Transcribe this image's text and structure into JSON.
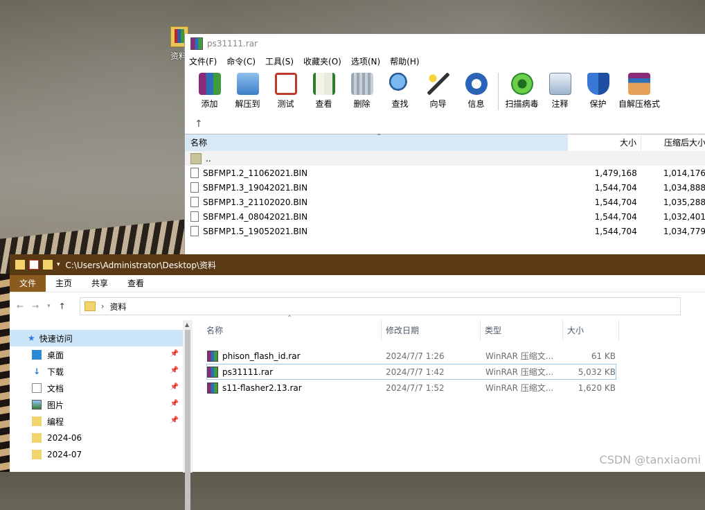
{
  "desktop": {
    "icon_label": "资料"
  },
  "winrar": {
    "title": "ps31111.rar",
    "menu": [
      "文件(F)",
      "命令(C)",
      "工具(S)",
      "收藏夹(O)",
      "选项(N)",
      "帮助(H)"
    ],
    "toolbar": [
      "添加",
      "解压到",
      "测试",
      "查看",
      "删除",
      "查找",
      "向导",
      "信息",
      "扫描病毒",
      "注释",
      "保护",
      "自解压格式"
    ],
    "up_arrow": "↑",
    "columns": {
      "name": "名称",
      "size": "大小",
      "packed": "压缩后大小"
    },
    "parent_row": "..",
    "files": [
      {
        "name": "SBFMP1.2_11062021.BIN",
        "size": "1,479,168",
        "packed": "1,014,176"
      },
      {
        "name": "SBFMP1.3_19042021.BIN",
        "size": "1,544,704",
        "packed": "1,034,888"
      },
      {
        "name": "SBFMP1.3_21102020.BIN",
        "size": "1,544,704",
        "packed": "1,035,288"
      },
      {
        "name": "SBFMP1.4_08042021.BIN",
        "size": "1,544,704",
        "packed": "1,032,401"
      },
      {
        "name": "SBFMP1.5_19052021.BIN",
        "size": "1,544,704",
        "packed": "1,034,779"
      }
    ]
  },
  "explorer": {
    "title": "C:\\Users\\Administrator\\Desktop\\资料",
    "ribbon": [
      "文件",
      "主页",
      "共享",
      "查看"
    ],
    "address": "资料",
    "nav": {
      "header": "快速访问",
      "items": [
        "桌面",
        "下载",
        "文档",
        "图片",
        "编程",
        "2024-06",
        "2024-07"
      ]
    },
    "columns": {
      "name": "名称",
      "date": "修改日期",
      "type": "类型",
      "size": "大小"
    },
    "files": [
      {
        "name": "phison_flash_id.rar",
        "date": "2024/7/7 1:26",
        "type": "WinRAR 压缩文...",
        "size": "61 KB"
      },
      {
        "name": "ps31111.rar",
        "date": "2024/7/7 1:42",
        "type": "WinRAR 压缩文...",
        "size": "5,032 KB"
      },
      {
        "name": "s11-flasher2.13.rar",
        "date": "2024/7/7 1:52",
        "type": "WinRAR 压缩文...",
        "size": "1,620 KB"
      }
    ]
  },
  "watermark": "CSDN @tanxiaomi"
}
